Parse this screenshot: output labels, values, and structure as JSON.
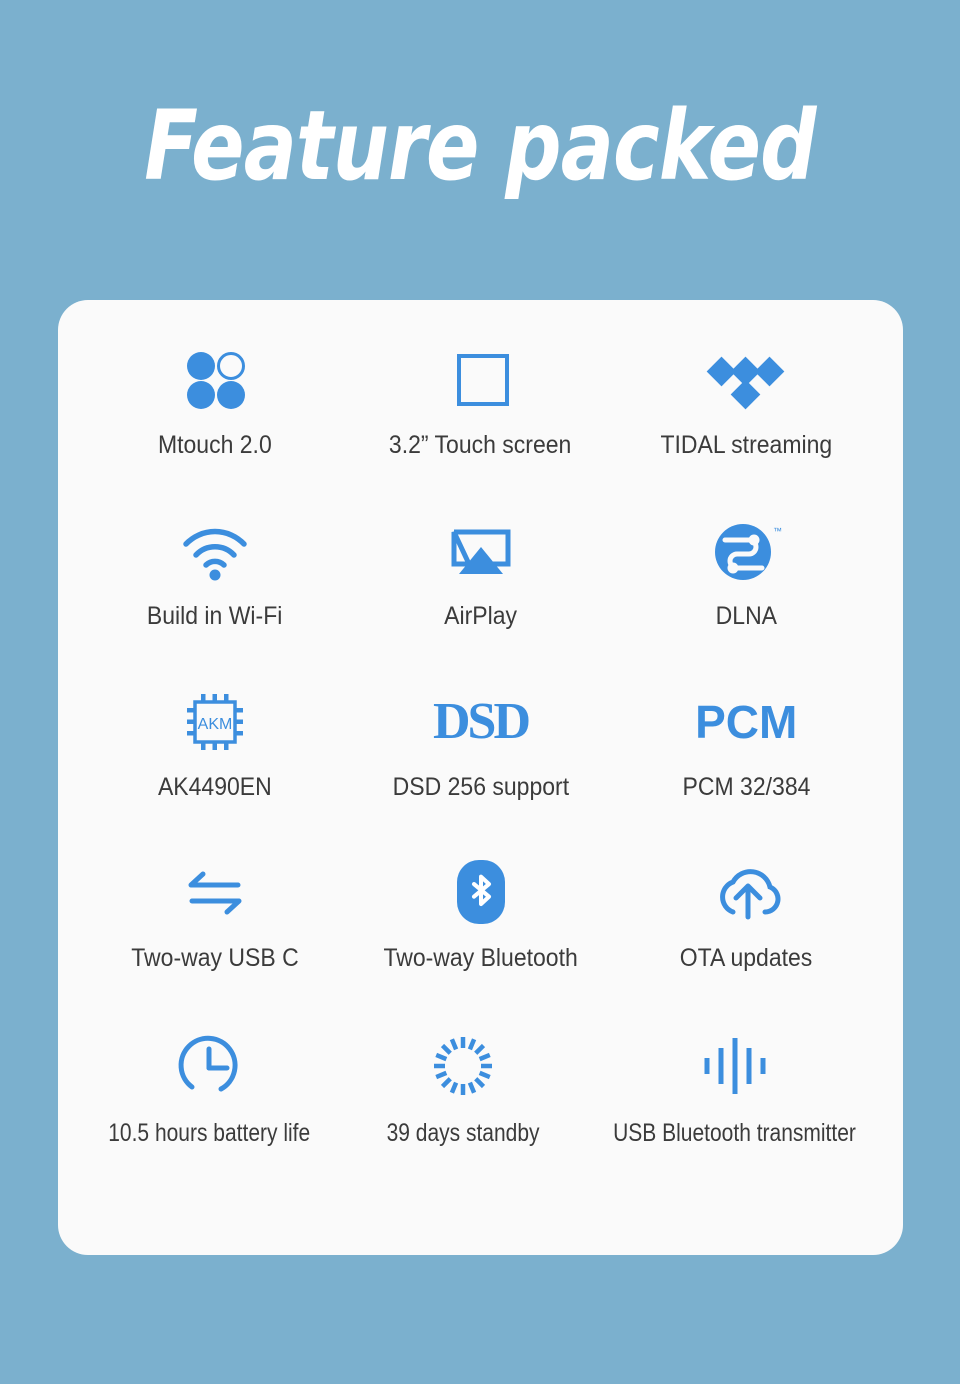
{
  "theme": {
    "background_color": "#7bb0ce",
    "card_color": "#fafafa",
    "accent_color": "#3c8ede",
    "title_color": "#ffffff",
    "label_color": "#3b3b3b"
  },
  "header": {
    "title": "Feature packed"
  },
  "features": {
    "rows": [
      {
        "items": [
          {
            "icon": "mtouch-four-dots-icon",
            "label": "Mtouch 2.0"
          },
          {
            "icon": "square-outline-touchscreen-icon",
            "label": "3.2” Touch screen"
          },
          {
            "icon": "tidal-diamonds-icon",
            "label": "TIDAL streaming"
          }
        ]
      },
      {
        "items": [
          {
            "icon": "wifi-icon",
            "label": "Build in Wi-Fi"
          },
          {
            "icon": "airplay-icon",
            "label": "AirPlay"
          },
          {
            "icon": "dlna-icon",
            "label": "DLNA"
          }
        ]
      },
      {
        "items": [
          {
            "icon": "akm-chip-icon",
            "label": "AK4490EN"
          },
          {
            "icon": "dsd-wordmark-icon",
            "label": "DSD 256 support",
            "wordmark": "DSD"
          },
          {
            "icon": "pcm-wordmark-icon",
            "label": "PCM 32/384",
            "wordmark": "PCM"
          }
        ]
      },
      {
        "items": [
          {
            "icon": "two-way-arrows-icon",
            "label": "Two-way USB C"
          },
          {
            "icon": "bluetooth-icon",
            "label": "Two-way Bluetooth"
          },
          {
            "icon": "cloud-upload-ota-icon",
            "label": "OTA updates"
          }
        ]
      },
      {
        "compact": true,
        "items": [
          {
            "icon": "clock-icon",
            "label": "10.5 hours battery life"
          },
          {
            "icon": "standby-spinner-icon",
            "label": "39 days standby"
          },
          {
            "icon": "audio-waveform-icon",
            "label": "USB Bluetooth transmitter"
          }
        ]
      }
    ]
  }
}
